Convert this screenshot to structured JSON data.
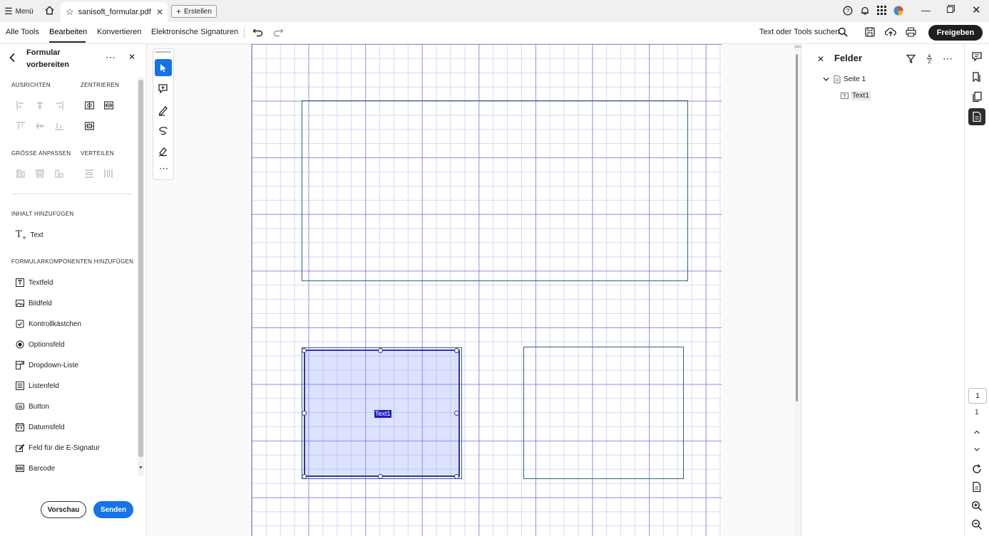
{
  "titlebar": {
    "menu_label": "Menü",
    "doc_title": "sanisoft_formular.pdf",
    "create_label": "Erstellen"
  },
  "menubar": {
    "items": [
      "Alle Tools",
      "Bearbeiten",
      "Konvertieren",
      "Elektronische Signaturen"
    ],
    "active": "Bearbeiten",
    "search_label": "Text oder Tools suchen",
    "share_label": "Freigeben"
  },
  "leftpanel": {
    "title": "Formular vorbereiten",
    "align_label": "AUSRICHTEN",
    "center_label": "ZENTRIEREN",
    "resize_label": "GRÖSSE ANPASSEN",
    "distribute_label": "VERTEILEN",
    "add_content_label": "INHALT HINZUFÜGEN",
    "text_tool": "Text",
    "add_components_label": "FORMULARKOMPONENTEN HINZUFÜGEN",
    "components": [
      "Textfeld",
      "Bildfeld",
      "Kontrollkästchen",
      "Optionsfeld",
      "Dropdown-Liste",
      "Listenfeld",
      "Button",
      "Datumsfeld",
      "Feld für die E-Signatur",
      "Barcode"
    ],
    "preview_label": "Vorschau",
    "send_label": "Senden"
  },
  "canvas": {
    "selected_field_label": "Text1"
  },
  "rightpanel": {
    "title": "Felder",
    "tree_page": "Seite 1",
    "tree_field": "Text1"
  },
  "rightrail": {
    "page_current": "1",
    "page_total": "1"
  },
  "colors": {
    "accent": "#1473e6",
    "grid_major": "#5a5ad2",
    "field_border": "#31607e",
    "selection": "#1c1ccc"
  }
}
